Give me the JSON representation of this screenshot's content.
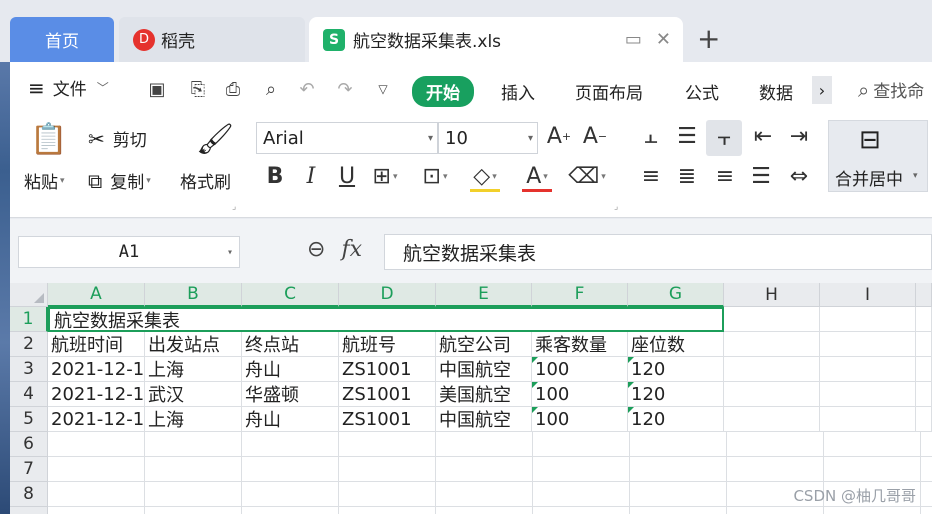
{
  "tabs": {
    "home": "首页",
    "daoke": "稻壳",
    "daoke_logo": "D",
    "file": "航空数据采集表.xls",
    "file_logo": "S",
    "new_tab": "+"
  },
  "menu": {
    "file": "文件",
    "start": "开始",
    "insert": "插入",
    "page_layout": "页面布局",
    "formula": "公式",
    "data": "数据",
    "more": "›",
    "search": "查找命"
  },
  "ribbon": {
    "paste": "粘贴",
    "cut": "剪切",
    "copy": "复制",
    "format_painter": "格式刷",
    "font_name": "Arial",
    "font_size": "10",
    "merge_center": "合并居中"
  },
  "formula_bar": {
    "name_box": "A1",
    "content": "航空数据采集表"
  },
  "sheet": {
    "columns": [
      "A",
      "B",
      "C",
      "D",
      "E",
      "F",
      "G",
      "H",
      "I"
    ],
    "rows": [
      "1",
      "2",
      "3",
      "4",
      "5",
      "6",
      "7",
      "8"
    ],
    "title": "航空数据采集表",
    "headers": [
      "航班时间",
      "出发站点",
      "终点站",
      "航班号",
      "航空公司",
      "乘客数量",
      "座位数"
    ],
    "data": [
      [
        "2021-12-1",
        "上海",
        "舟山",
        "ZS1001",
        "中国航空",
        "100",
        "120"
      ],
      [
        "2021-12-1",
        "武汉",
        "华盛顿",
        "ZS1001",
        "美国航空",
        "100",
        "120"
      ],
      [
        "2021-12-1",
        "上海",
        "舟山",
        "ZS1001",
        "中国航空",
        "100",
        "120"
      ]
    ]
  },
  "watermark": "CSDN @柚几哥哥",
  "colors": {
    "accent": "#18a05f",
    "home_tab": "#5a8de6"
  }
}
